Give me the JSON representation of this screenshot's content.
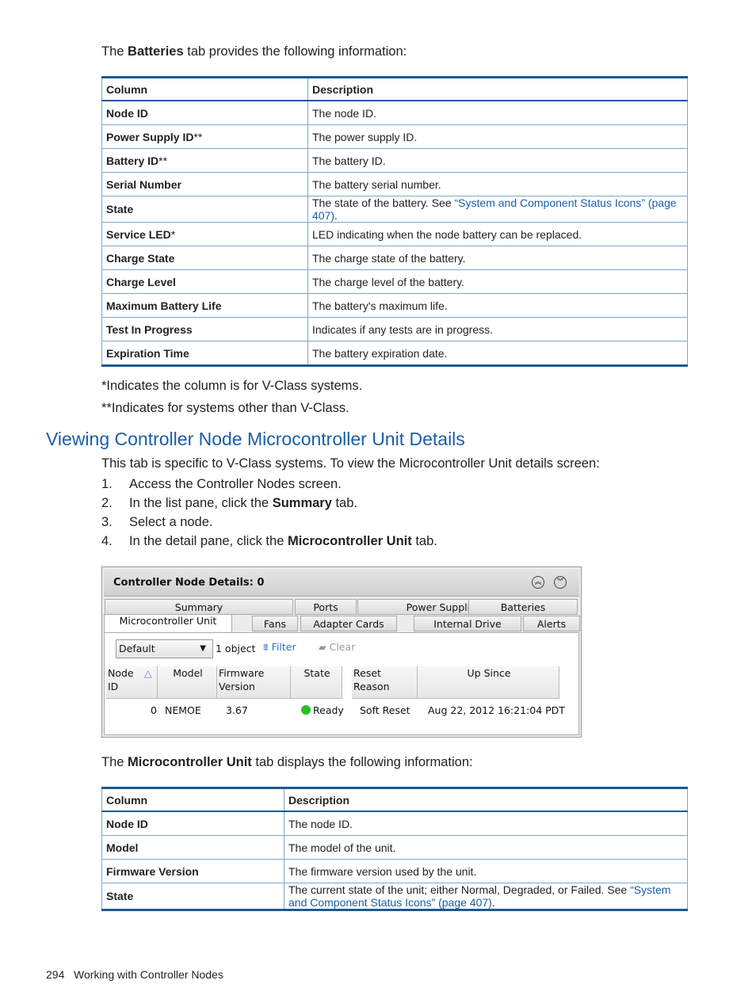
{
  "intro1": {
    "pre": "The ",
    "bold": "Batteries",
    "post": " tab provides the following information:"
  },
  "table1": {
    "headers": [
      "Column",
      "Description"
    ],
    "rows": [
      {
        "col": "Node ID",
        "mark": "",
        "desc": "The node ID."
      },
      {
        "col": "Power Supply ID",
        "mark": "**",
        "desc": "The power supply ID."
      },
      {
        "col": "Battery ID",
        "mark": "**",
        "desc": "The battery ID."
      },
      {
        "col": "Serial Number",
        "mark": "",
        "desc": "The battery serial number."
      },
      {
        "col": "State",
        "mark": "",
        "desc": "The state of the battery. See ",
        "link": "“System and Component Status Icons” (page 407)",
        "post": "."
      },
      {
        "col": "Service LED",
        "mark": "*",
        "desc": "LED indicating when the node battery can be replaced."
      },
      {
        "col": "Charge State",
        "mark": "",
        "desc": "The charge state of the battery."
      },
      {
        "col": "Charge Level",
        "mark": "",
        "desc": "The charge level of the battery."
      },
      {
        "col": "Maximum Battery Life",
        "mark": "",
        "desc": "The battery's maximum life."
      },
      {
        "col": "Test In Progress",
        "mark": "",
        "desc": "Indicates if any tests are in progress."
      },
      {
        "col": "Expiration Time",
        "mark": "",
        "desc": "The battery expiration date."
      }
    ]
  },
  "note1": "*Indicates the column is for V-Class systems.",
  "note2": "**Indicates for systems other than V-Class.",
  "heading": "Viewing Controller Node Microcontroller Unit Details",
  "para": "This tab is specific to V-Class systems. To view the Microcontroller Unit details screen:",
  "steps": [
    {
      "n": "1.",
      "pre": "Access the Controller Nodes screen.",
      "bold": "",
      "post": ""
    },
    {
      "n": "2.",
      "pre": "In the list pane, click the ",
      "bold": "Summary",
      "post": " tab."
    },
    {
      "n": "3.",
      "pre": "Select a node.",
      "bold": "",
      "post": ""
    },
    {
      "n": "4.",
      "pre": "In the detail pane, click the ",
      "bold": "Microcontroller Unit",
      "post": " tab."
    }
  ],
  "screenshot": {
    "title": "Controller Node Details: 0",
    "tabs_row1": [
      "Summary",
      "Ports",
      "Power Supplies",
      "Batteries"
    ],
    "tabs_row2": [
      "Microcontroller Unit",
      "Fans",
      "Adapter Cards",
      "Internal Drive",
      "Alerts"
    ],
    "view_select": "Default",
    "object_count": "1 object",
    "filter": "Filter",
    "clear": "Clear",
    "columns": [
      "Node ID",
      "Model",
      "Firmware Version",
      "State",
      "Reset Reason",
      "Up Since"
    ],
    "row": {
      "node_id": "0",
      "model": "NEMOE",
      "firmware": "3.67",
      "state": "Ready",
      "reset": "Soft Reset",
      "up_since": "Aug 22, 2012 16:21:04 PDT"
    },
    "state_color": "#21c321"
  },
  "intro2": {
    "pre": "The ",
    "bold": "Microcontroller Unit",
    "post": " tab displays the following information:"
  },
  "table2": {
    "headers": [
      "Column",
      "Description"
    ],
    "rows": [
      {
        "col": "Node ID",
        "desc": "The node ID."
      },
      {
        "col": "Model",
        "desc": "The model of the unit."
      },
      {
        "col": "Firmware Version",
        "desc": "The firmware version used by the unit."
      },
      {
        "col": "State",
        "desc": "The current state of the unit; either Normal, Degraded, or Failed. See ",
        "link": "“System and Component Status Icons” (page 407)",
        "post": "."
      }
    ]
  },
  "footer": {
    "page": "294",
    "title": "Working with Controller Nodes"
  }
}
